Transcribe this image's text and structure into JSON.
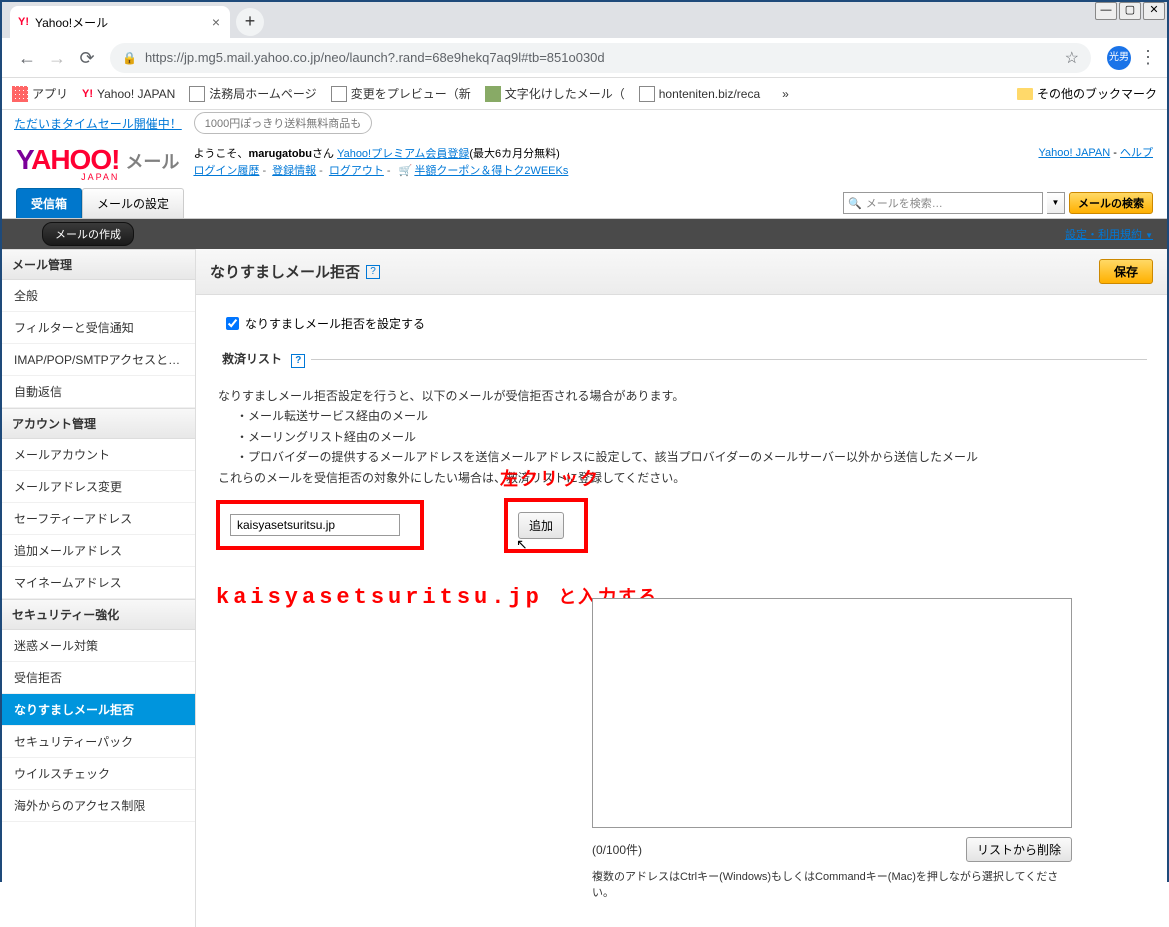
{
  "window_controls": {
    "min": "—",
    "max": "▢",
    "close": "✕"
  },
  "tab": {
    "title": "Yahoo!メール",
    "favicon": "Y!"
  },
  "browser": {
    "url": "https://jp.mg5.mail.yahoo.co.jp/neo/launch?.rand=68e9hekq7aq9l#tb=851o030d",
    "avatar": "光男"
  },
  "bookmarks": {
    "apps": "アプリ",
    "items": [
      {
        "label": "Yahoo! JAPAN",
        "icon": "yj"
      },
      {
        "label": "法務局ホームページ",
        "icon": "page"
      },
      {
        "label": "変更をプレビュー（新",
        "icon": "page"
      },
      {
        "label": "文字化けしたメール（",
        "icon": "img"
      },
      {
        "label": "honteniten.biz/reca",
        "icon": "page"
      }
    ],
    "chevron": "»",
    "other": "その他のブックマーク"
  },
  "promo": {
    "link": "ただいまタイムセール開催中！",
    "pill": "1000円ぽっきり送料無料商品も"
  },
  "header": {
    "logo": {
      "y": "Y",
      "ahoo": "AHOO",
      "excl": "!",
      "japan": "JAPAN",
      "mail": "メール"
    },
    "greeting": "ようこそ、",
    "username": "marugatobu",
    "san": "さん",
    "premium": "Yahoo!プレミアム会員登録",
    "premium_note": "(最大6カ月分無料)",
    "links": {
      "login_history": "ログイン履歴",
      "reg_info": "登録情報",
      "logout": "ログアウト",
      "coupon": "半額クーポン＆得トク2WEEKs"
    },
    "right": {
      "yj": "Yahoo! JAPAN",
      "help": "ヘルプ"
    }
  },
  "main_tabs": {
    "inbox": "受信箱",
    "settings": "メールの設定"
  },
  "search": {
    "placeholder": "メールを検索…",
    "button": "メールの検索"
  },
  "compose": "メールの作成",
  "settings_terms": "設定・利用規約",
  "sidebar": {
    "sections": [
      {
        "title": "メール管理",
        "items": [
          "全般",
          "フィルターと受信通知",
          "IMAP/POP/SMTPアクセスと…",
          "自動返信"
        ]
      },
      {
        "title": "アカウント管理",
        "items": [
          "メールアカウント",
          "メールアドレス変更",
          "セーフティーアドレス",
          "追加メールアドレス",
          "マイネームアドレス"
        ]
      },
      {
        "title": "セキュリティー強化",
        "items": [
          "迷惑メール対策",
          "受信拒否",
          "なりすましメール拒否",
          "セキュリティーパック",
          "ウイルスチェック",
          "海外からのアクセス制限"
        ]
      }
    ]
  },
  "page": {
    "title": "なりすましメール拒否",
    "save": "保存",
    "checkbox_label": "なりすましメール拒否を設定する",
    "fieldset_legend": "救済リスト",
    "desc1": "なりすましメール拒否設定を行うと、以下のメールが受信拒否される場合があります。",
    "desc2": "・メール転送サービス経由のメール",
    "desc3": "・メーリングリスト経由のメール",
    "desc4": "・プロバイダーの提供するメールアドレスを送信メールアドレスに設定して、該当プロバイダーのメールサーバー以外から送信したメール",
    "desc5_a": "これらのメールを受信拒否の対象外にしたい場合は、救済リストに登録してください。",
    "input_value": "kaisyasetsuritsu.jp",
    "add_button": "追加",
    "count": "(0/100件)",
    "delete_button": "リストから削除",
    "note": "複数のアドレスはCtrlキー(Windows)もしくはCommandキー(Mac)を押しながら選択してください。"
  },
  "annotations": {
    "left_click": "左クリック",
    "input_instr_a": "kaisyasetsuritsu.jp",
    "input_instr_b": "と入力する"
  }
}
